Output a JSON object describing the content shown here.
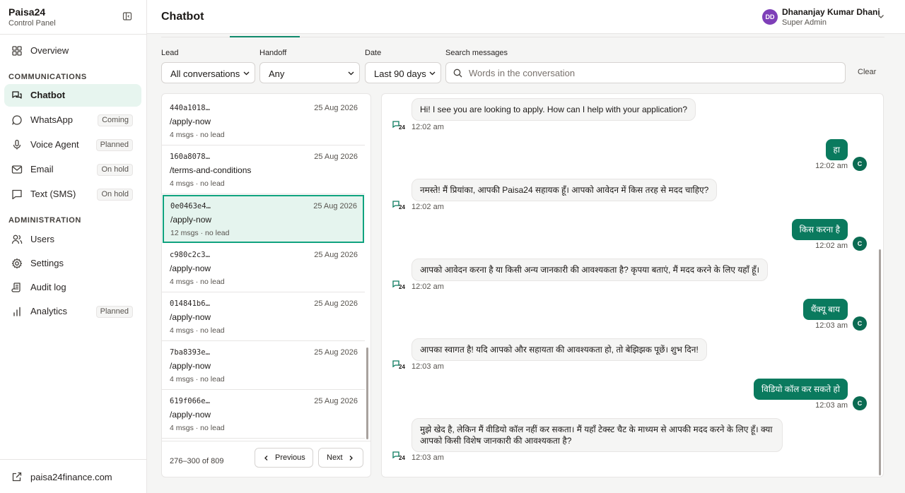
{
  "brand": {
    "name": "Paisa24",
    "subtitle": "Control Panel"
  },
  "nav": {
    "overview": "Overview",
    "communications_label": "COMMUNICATIONS",
    "chatbot": "Chatbot",
    "whatsapp": "WhatsApp",
    "whatsapp_badge": "Coming",
    "voice": "Voice Agent",
    "voice_badge": "Planned",
    "email": "Email",
    "email_badge": "On hold",
    "sms": "Text (SMS)",
    "sms_badge": "On hold",
    "administration_label": "ADMINISTRATION",
    "users": "Users",
    "settings": "Settings",
    "audit": "Audit log",
    "analytics": "Analytics",
    "analytics_badge": "Planned",
    "footer_link": "paisa24finance.com"
  },
  "header": {
    "title": "Chatbot",
    "user_initials": "DD",
    "user_name": "Dhananjay Kumar Dhani",
    "user_role": "Super Admin"
  },
  "filters": {
    "lead_label": "Lead",
    "lead_value": "All conversations",
    "handoff_label": "Handoff",
    "handoff_value": "Any",
    "date_label": "Date",
    "date_value": "Last 90 days",
    "search_label": "Search messages",
    "search_placeholder": "Words in the conversation",
    "clear": "Clear"
  },
  "conversations": [
    {
      "id": "440a1018…",
      "date": "25 Aug 2026",
      "path": "/apply-now",
      "meta": "4 msgs · no lead"
    },
    {
      "id": "160a8078…",
      "date": "25 Aug 2026",
      "path": "/terms-and-conditions",
      "meta": "4 msgs · no lead"
    },
    {
      "id": "0e0463e4…",
      "date": "25 Aug 2026",
      "path": "/apply-now",
      "meta": "12 msgs · no lead"
    },
    {
      "id": "c980c2c3…",
      "date": "25 Aug 2026",
      "path": "/apply-now",
      "meta": "4 msgs · no lead"
    },
    {
      "id": "014841b6…",
      "date": "25 Aug 2026",
      "path": "/apply-now",
      "meta": "4 msgs · no lead"
    },
    {
      "id": "7ba8393e…",
      "date": "25 Aug 2026",
      "path": "/apply-now",
      "meta": "4 msgs · no lead"
    },
    {
      "id": "619f066e…",
      "date": "25 Aug 2026",
      "path": "/apply-now",
      "meta": "4 msgs · no lead"
    }
  ],
  "pagination": {
    "range": "276–300 of 809",
    "previous": "Previous",
    "next": "Next"
  },
  "messages": [
    {
      "role": "bot",
      "text": "Hi! I see you are looking to apply. How can I help with your application?",
      "time": "12:02 am"
    },
    {
      "role": "user",
      "text": "हा",
      "time": "12:02 am",
      "avatar": "C"
    },
    {
      "role": "bot",
      "text": "नमस्ते! मैं प्रियांका, आपकी Paisa24 सहायक हूँ। आपको आवेदन में किस तरह से मदद चाहिए?",
      "time": "12:02 am"
    },
    {
      "role": "user",
      "text": "किस करना है",
      "time": "12:02 am",
      "avatar": "C"
    },
    {
      "role": "bot",
      "text": "आपको आवेदन करना है या किसी अन्य जानकारी की आवश्यकता है? कृपया बताएं, मैं मदद करने के लिए यहाँ हूँ।",
      "time": "12:02 am"
    },
    {
      "role": "user",
      "text": "थैंक्यू बाय",
      "time": "12:03 am",
      "avatar": "C"
    },
    {
      "role": "bot",
      "text": "आपका स्वागत है! यदि आपको और सहायता की आवश्यकता हो, तो बेझिझक पूछें। शुभ दिन!",
      "time": "12:03 am"
    },
    {
      "role": "user",
      "text": "विडियो कॉल कर सकते हो",
      "time": "12:03 am",
      "avatar": "C"
    },
    {
      "role": "bot",
      "text": "मुझे खेद है, लेकिन मैं वीडियो कॉल नहीं कर सकता। मैं यहाँ टेक्स्ट चैट के माध्यम से आपकी मदद करने के लिए हूँ। क्या आपको किसी विशेष जानकारी की आवश्यकता है?",
      "time": "12:03 am"
    }
  ],
  "colors": {
    "accent": "#10a37f",
    "user_bubble": "#0a7a5e",
    "avatar": "#7e3fb8"
  }
}
